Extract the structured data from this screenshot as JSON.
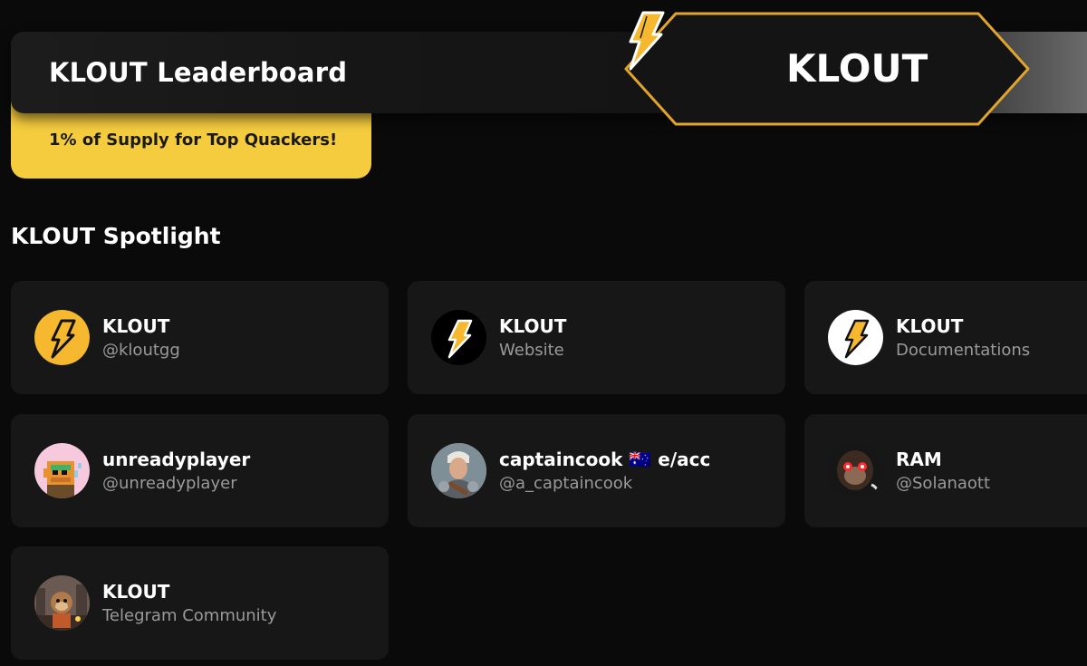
{
  "header": {
    "title": "KLOUT Leaderboard",
    "promo": "1% of Supply for Top Quackers!",
    "badge_text": "KLOUT",
    "badge_icon": "lightning-bolt-icon"
  },
  "spotlight": {
    "title": "KLOUT Spotlight",
    "cards": [
      {
        "name": "KLOUT",
        "sub": "@kloutgg",
        "avatar": "klout-logo-yellow"
      },
      {
        "name": "KLOUT",
        "sub": "Website",
        "avatar": "klout-logo-black"
      },
      {
        "name": "KLOUT",
        "sub": "Documentations",
        "avatar": "klout-logo-white"
      },
      {
        "name": "unreadyplayer",
        "sub": "@unreadyplayer",
        "avatar": "pixel-ape-avatar"
      },
      {
        "name": "captaincook 🇦🇺 e/acc",
        "sub": "@a_captaincook",
        "avatar": "warrior-portrait-avatar"
      },
      {
        "name": "RAM",
        "sub": "@Solanaott",
        "avatar": "laser-eyes-monkey-avatar"
      },
      {
        "name": "KLOUT",
        "sub": "Telegram Community",
        "avatar": "monkey-city-avatar"
      }
    ]
  },
  "colors": {
    "accent": "#f5cc3e",
    "badge_border": "#e0a52a",
    "card_bg": "#171717",
    "page_bg": "#0a0a0a",
    "muted_text": "#9a9a9a"
  }
}
